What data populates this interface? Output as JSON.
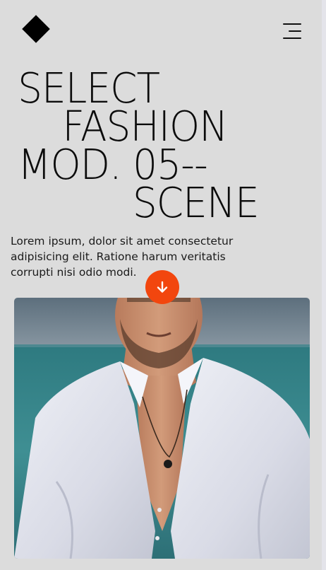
{
  "header": {
    "logo_icon": "diamond-icon",
    "menu_icon": "hamburger-menu-icon"
  },
  "hero": {
    "title_lines": [
      "SELECT",
      "FASHION",
      "MOD. 05--",
      "SCENE"
    ],
    "intro": "Lorem ipsum, dolor sit amet consectetur adipisicing elit. Ratione harum veritatis corrupti nisi odio modi."
  },
  "scroll_button": {
    "icon": "arrow-down-icon",
    "color": "#f2460e"
  },
  "photo": {
    "subject": "model in white shirt at beach"
  },
  "colors": {
    "background": "#dcdcdc",
    "accent": "#f2460e",
    "text": "#111111"
  }
}
